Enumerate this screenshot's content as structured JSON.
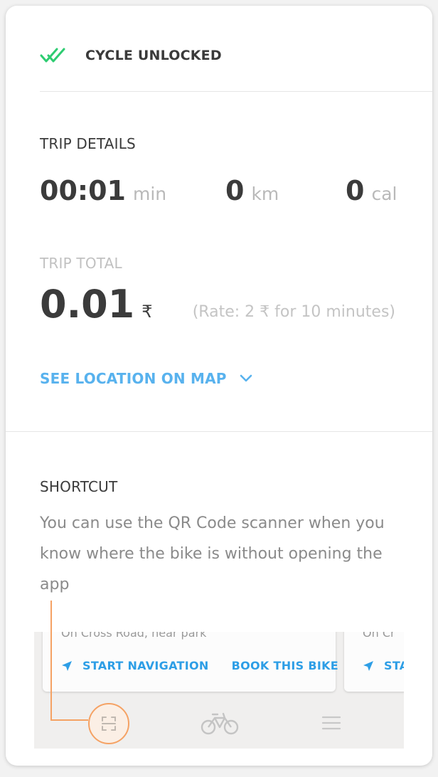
{
  "status": {
    "label": "CYCLE UNLOCKED",
    "icon": "double-check-icon",
    "icon_color": "#2ecc71"
  },
  "trip_details": {
    "heading": "TRIP DETAILS",
    "duration": {
      "value": "00:01",
      "unit": "min"
    },
    "distance": {
      "value": "0",
      "unit": "km"
    },
    "calories": {
      "value": "0",
      "unit": "cal"
    }
  },
  "trip_total": {
    "heading": "TRIP TOTAL",
    "amount": "0.01",
    "currency": "₹",
    "rate_text": "(Rate: 2 ₹ for 10 minutes)"
  },
  "map_link": {
    "label": "SEE LOCATION ON MAP",
    "icon": "chevron-down-icon",
    "color": "#58b2ee"
  },
  "shortcut": {
    "heading": "SHORTCUT",
    "text": "You can use the QR Code scanner when you know where the bike is without opening the app"
  },
  "app_preview": {
    "card_1_address": "On Cross Road, near park",
    "card_2_address": "On Cr",
    "start_navigation_label": "START NAVIGATION",
    "book_bike_label": "BOOK THIS BIKE",
    "card_2_action_label": "STA",
    "action_color": "#2d9ee6",
    "highlight_color": "#f5a264",
    "bottom_bar_icons": [
      "qr-scanner-icon",
      "bike-icon",
      "menu-icon"
    ]
  }
}
